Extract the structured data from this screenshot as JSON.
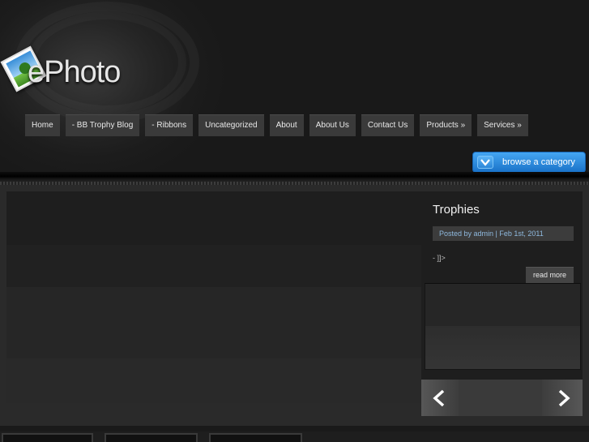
{
  "brand": {
    "logo_text": "ePhoto"
  },
  "nav": {
    "items": [
      {
        "label": "Home"
      },
      {
        "label": "- BB Trophy Blog"
      },
      {
        "label": "- Ribbons"
      },
      {
        "label": "Uncategorized"
      },
      {
        "label": "About"
      },
      {
        "label": "About Us"
      },
      {
        "label": "Contact Us"
      },
      {
        "label": "Products »"
      },
      {
        "label": "Services »"
      }
    ]
  },
  "browse": {
    "label": "browse a category",
    "color": "#2f8fe3"
  },
  "featured": {
    "title": "Trophies",
    "meta": "Posted by admin | Feb 1st, 2011",
    "excerpt": "- ]]>",
    "read_more": "read more"
  },
  "icons": {
    "logo": "photo-icon",
    "browse": "chevron-down-icon",
    "prev": "arrow-left-icon",
    "next": "arrow-right-icon"
  }
}
